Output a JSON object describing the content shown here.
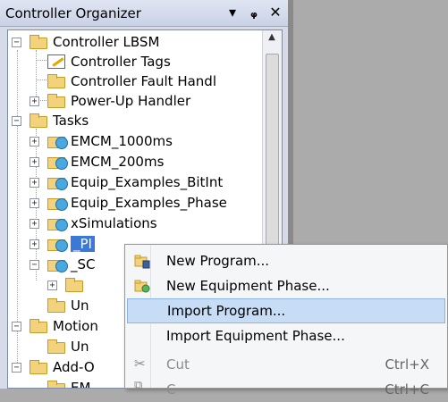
{
  "panel": {
    "title": "Controller Organizer",
    "controls": [
      "▾",
      "ᵩ",
      "✕"
    ]
  },
  "tree": [
    {
      "label": "Controller LBSM",
      "expanded": true,
      "icon": "folder-open-icon"
    },
    {
      "label": "Controller Tags",
      "icon": "tags-icon"
    },
    {
      "label": "Controller Fault Handl",
      "icon": "folder-icon"
    },
    {
      "label": "Power-Up Handler",
      "icon": "folder-icon"
    },
    {
      "label": "Tasks",
      "expanded": true,
      "icon": "folder-open-icon"
    },
    {
      "label": "EMCM_1000ms",
      "icon": "task-icon"
    },
    {
      "label": "EMCM_200ms",
      "icon": "task-icon"
    },
    {
      "label": "Equip_Examples_BitInt",
      "icon": "task-icon"
    },
    {
      "label": "Equip_Examples_Phase",
      "icon": "task-icon"
    },
    {
      "label": "xSimulations",
      "icon": "task-icon"
    },
    {
      "label": "_PI",
      "icon": "task-icon",
      "selected": true
    },
    {
      "label": "_SC",
      "icon": "task-icon"
    },
    {
      "label": "",
      "icon": "program-icon"
    },
    {
      "label": "Un",
      "icon": "folder-icon"
    },
    {
      "label": "Motion",
      "icon": "folder-open-icon"
    },
    {
      "label": "Un",
      "icon": "folder-icon"
    },
    {
      "label": "Add-O",
      "icon": "folder-open-icon"
    },
    {
      "label": "EM",
      "icon": "folder-icon"
    }
  ],
  "context_menu": {
    "items": [
      {
        "label": "New Program...",
        "icon": "new-program-icon",
        "shortcut": ""
      },
      {
        "label": "New Equipment Phase...",
        "icon": "new-phase-icon",
        "shortcut": ""
      },
      {
        "label": "Import Program...",
        "icon": "",
        "shortcut": "",
        "highlighted": true
      },
      {
        "label": "Import Equipment Phase...",
        "icon": "",
        "shortcut": ""
      },
      {
        "label": "Cut",
        "icon": "cut-icon",
        "shortcut": "Ctrl+X",
        "disabled": true
      },
      {
        "label": "C",
        "icon": "copy-icon",
        "shortcut": "Ctrl+C",
        "disabled": true
      }
    ]
  },
  "colors": {
    "selection": "#3b79d8",
    "menu_highlight": "#c7dcf5",
    "panel_bg": "#d6dbe9",
    "workspace": "#ababab"
  }
}
